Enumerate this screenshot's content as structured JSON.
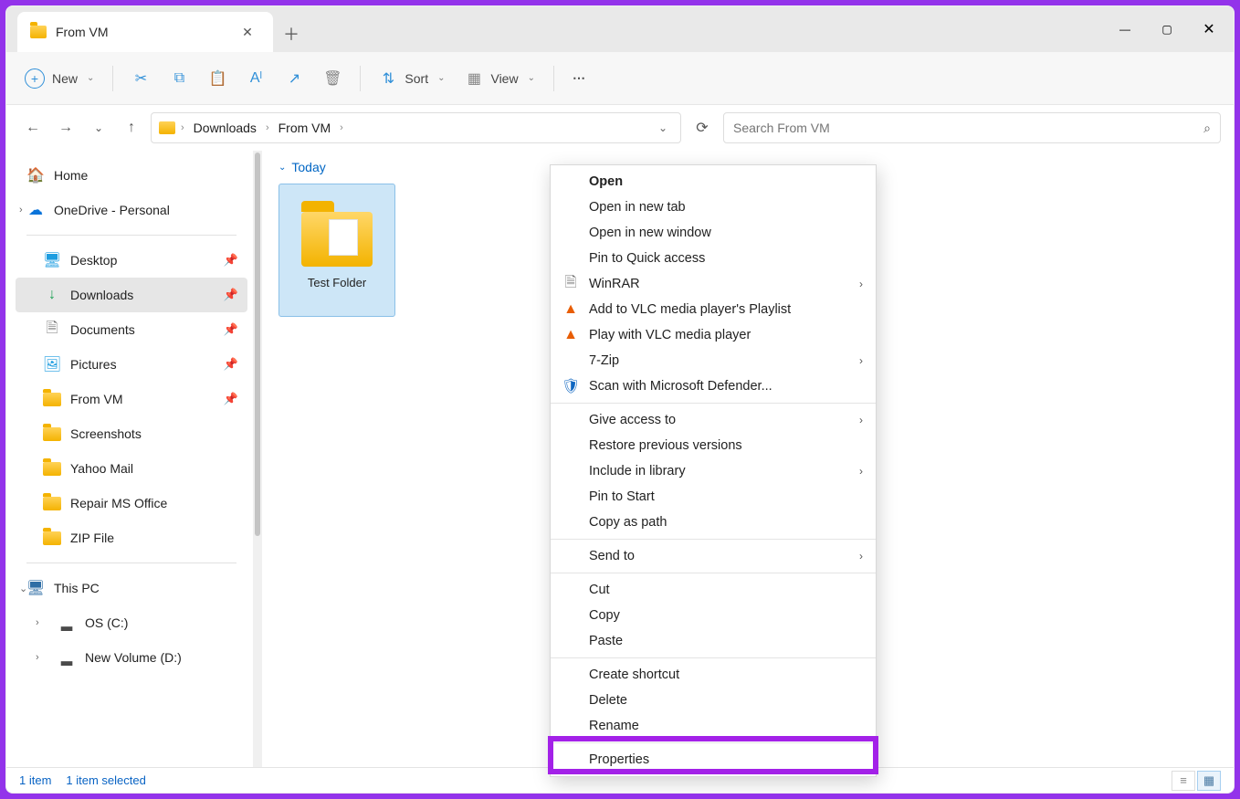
{
  "tab": {
    "title": "From VM"
  },
  "toolbar": {
    "new": "New",
    "sort": "Sort",
    "view": "View"
  },
  "breadcrumbs": [
    "Downloads",
    "From VM"
  ],
  "search": {
    "placeholder": "Search From VM"
  },
  "sidebar": {
    "home": "Home",
    "onedrive": "OneDrive - Personal",
    "desktop": "Desktop",
    "downloads": "Downloads",
    "documents": "Documents",
    "pictures": "Pictures",
    "fromvm": "From VM",
    "screenshots": "Screenshots",
    "yahoomail": "Yahoo Mail",
    "repair": "Repair MS Office",
    "zipfile": "ZIP File",
    "thispc": "This PC",
    "osc": "OS (C:)",
    "nvd": "New Volume (D:)"
  },
  "content": {
    "group": "Today",
    "item": "Test Folder"
  },
  "context": {
    "open": "Open",
    "opentab": "Open in new tab",
    "openwin": "Open in new window",
    "pinquick": "Pin to Quick access",
    "winrar": "WinRAR",
    "addvlc": "Add to VLC media player's Playlist",
    "playvlc": "Play with VLC media player",
    "sevenzip": "7-Zip",
    "defender": "Scan with Microsoft Defender...",
    "giveaccess": "Give access to",
    "restore": "Restore previous versions",
    "includelib": "Include in library",
    "pinstart": "Pin to Start",
    "copypath": "Copy as path",
    "sendto": "Send to",
    "cut": "Cut",
    "copy": "Copy",
    "paste": "Paste",
    "shortcut": "Create shortcut",
    "delete": "Delete",
    "rename": "Rename",
    "properties": "Properties"
  },
  "status": {
    "count": "1 item",
    "selected": "1 item selected"
  }
}
